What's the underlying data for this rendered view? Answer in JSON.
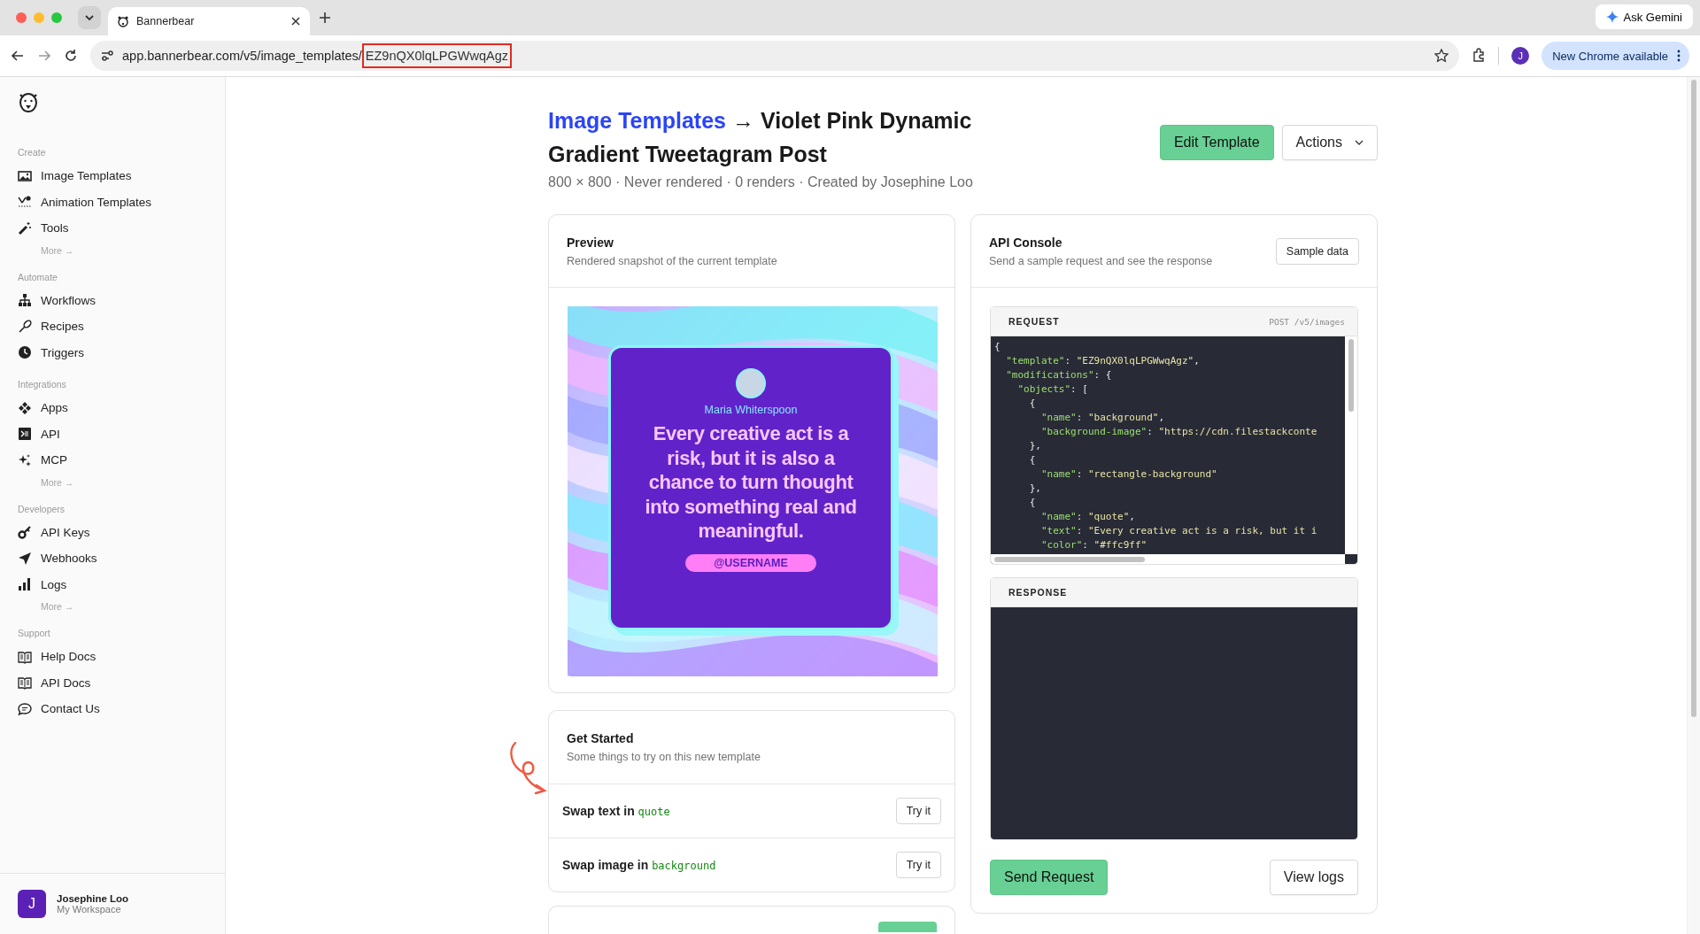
{
  "browser": {
    "tab_title": "Bannerbear",
    "url": {
      "base": "app.bannerbear.com/v5/image_templates/",
      "highlighted": "EZ9nQX0lqLPGWwqAgz"
    },
    "ask_gemini": "Ask Gemini",
    "profile_initial": "J",
    "update_button": "New Chrome available"
  },
  "sidebar": {
    "groups": [
      {
        "label": "Create",
        "items": [
          {
            "label": "Image Templates"
          },
          {
            "label": "Animation Templates"
          },
          {
            "label": "Tools"
          }
        ],
        "more": "More →"
      },
      {
        "label": "Automate",
        "items": [
          {
            "label": "Workflows"
          },
          {
            "label": "Recipes"
          },
          {
            "label": "Triggers"
          }
        ]
      },
      {
        "label": "Integrations",
        "items": [
          {
            "label": "Apps"
          },
          {
            "label": "API"
          },
          {
            "label": "MCP"
          }
        ],
        "more": "More →"
      },
      {
        "label": "Developers",
        "items": [
          {
            "label": "API Keys"
          },
          {
            "label": "Webhooks"
          },
          {
            "label": "Logs"
          }
        ],
        "more": "More →"
      },
      {
        "label": "Support",
        "items": [
          {
            "label": "Help Docs"
          },
          {
            "label": "API Docs"
          },
          {
            "label": "Contact Us"
          }
        ]
      }
    ],
    "user": {
      "initial": "J",
      "name": "Josephine Loo",
      "workspace": "My Workspace"
    }
  },
  "header": {
    "link": "Image Templates",
    "title": "→ Violet Pink Dynamic Gradient Tweetagram Post",
    "meta": "800 × 800 · Never rendered · 0 renders · Created by Josephine Loo",
    "edit_button": "Edit Template",
    "actions_button": "Actions"
  },
  "preview": {
    "title": "Preview",
    "subtitle": "Rendered snapshot of the current template",
    "image": {
      "name": "Maria Whiterspoon",
      "quote": "Every creative act is a risk, but it is also a chance to turn thought into something real and meaningful.",
      "handle": "@USERNAME"
    }
  },
  "get_started": {
    "title": "Get Started",
    "subtitle": "Some things to try on this new template",
    "rows": [
      {
        "text": "Swap text in",
        "target": "quote",
        "button": "Try it"
      },
      {
        "text": "Swap image in",
        "target": "background",
        "button": "Try it"
      }
    ]
  },
  "api_console": {
    "title": "API Console",
    "subtitle": "Send a sample request and see the response",
    "sample_button": "Sample data",
    "request": {
      "label": "REQUEST",
      "endpoint": "POST /v5/images",
      "lines": [
        "{",
        "  \"template\": \"EZ9nQX0lqLPGWwqAgz\",",
        "  \"modifications\": {",
        "    \"objects\": [",
        "      {",
        "        \"name\": \"background\",",
        "        \"background-image\": \"https://cdn.filestackconte",
        "      },",
        "      {",
        "        \"name\": \"rectangle-background\"",
        "      },",
        "      {",
        "        \"name\": \"quote\",",
        "        \"text\": \"Every creative act is a risk, but it i",
        "        \"color\": \"#ffc9ff\""
      ]
    },
    "response": {
      "label": "RESPONSE"
    },
    "send_button": "Send Request",
    "logs_button": "View logs"
  }
}
